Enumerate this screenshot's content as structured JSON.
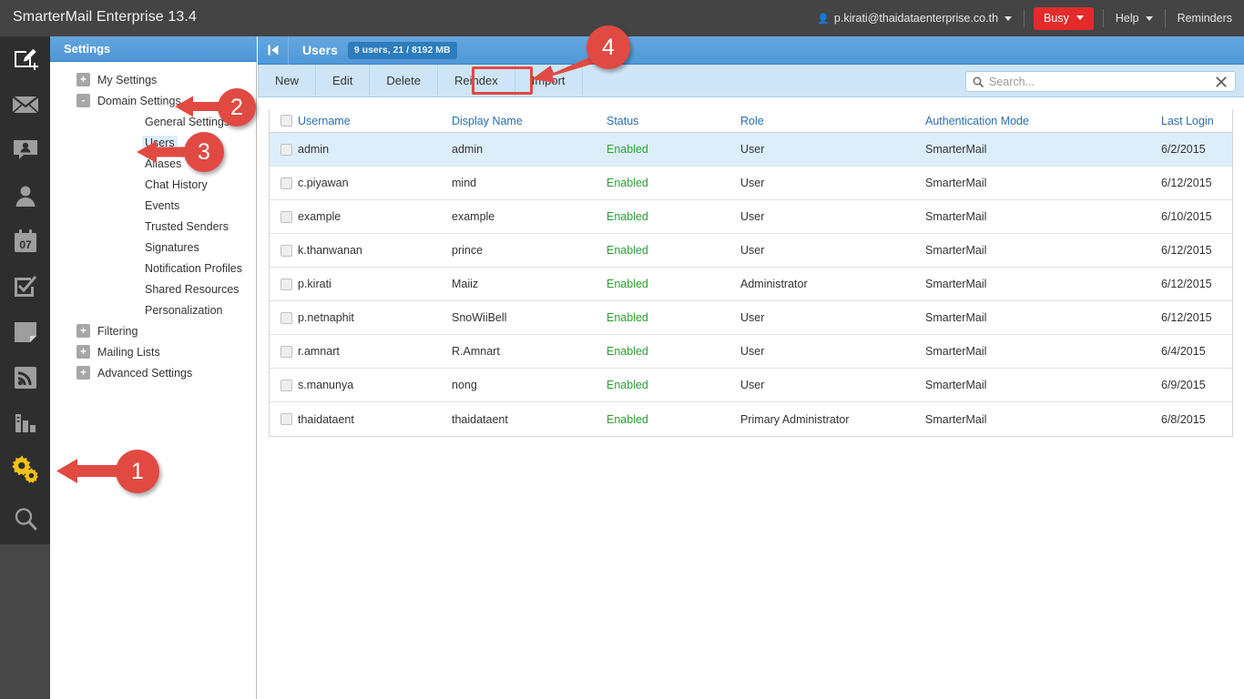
{
  "app": {
    "brand": "SmarterMail Enterprise 13.4",
    "accent_blue": "#4f98d7",
    "accent_red": "#e32b2b",
    "enabled_green": "#2e9e32"
  },
  "topbar": {
    "user_email": "p.kirati@thaidataenterprise.co.th",
    "status_label": "Busy",
    "help_label": "Help",
    "reminders_label": "Reminders"
  },
  "rail": {
    "items": [
      {
        "icon": "compose-new-icon",
        "label": "New"
      },
      {
        "icon": "email-icon",
        "label": "Email"
      },
      {
        "icon": "chat-icon",
        "label": "Chat"
      },
      {
        "icon": "contacts-icon",
        "label": "Contacts"
      },
      {
        "icon": "calendar-icon",
        "label": "Calendar"
      },
      {
        "icon": "tasks-icon",
        "label": "Tasks"
      },
      {
        "icon": "notes-icon",
        "label": "Notes"
      },
      {
        "icon": "rss-icon",
        "label": "RSS Feeds"
      },
      {
        "icon": "reports-icon",
        "label": "Reports"
      },
      {
        "icon": "settings-gear-icon",
        "label": "Settings"
      },
      {
        "icon": "search-icon",
        "label": "Search"
      }
    ]
  },
  "settings": {
    "header": "Settings",
    "tree": [
      {
        "label": "My Settings",
        "level": 1,
        "toggle": "+",
        "selected": false
      },
      {
        "label": "Domain Settings",
        "level": 1,
        "toggle": "-",
        "selected": false
      },
      {
        "label": "General Settings",
        "level": 2,
        "toggle": "",
        "selected": false
      },
      {
        "label": "Users",
        "level": 2,
        "toggle": "",
        "selected": true
      },
      {
        "label": "Aliases",
        "level": 2,
        "toggle": "",
        "selected": false
      },
      {
        "label": "Chat History",
        "level": 2,
        "toggle": "",
        "selected": false
      },
      {
        "label": "Events",
        "level": 2,
        "toggle": "",
        "selected": false
      },
      {
        "label": "Trusted Senders",
        "level": 2,
        "toggle": "",
        "selected": false
      },
      {
        "label": "Signatures",
        "level": 2,
        "toggle": "",
        "selected": false
      },
      {
        "label": "Notification Profiles",
        "level": 2,
        "toggle": "",
        "selected": false
      },
      {
        "label": "Shared Resources",
        "level": 2,
        "toggle": "",
        "selected": false
      },
      {
        "label": "Personalization",
        "level": 2,
        "toggle": "",
        "selected": false
      },
      {
        "label": "Filtering",
        "level": 1,
        "toggle": "+",
        "selected": false
      },
      {
        "label": "Mailing Lists",
        "level": 1,
        "toggle": "+",
        "selected": false
      },
      {
        "label": "Advanced Settings",
        "level": 1,
        "toggle": "+",
        "selected": false
      }
    ]
  },
  "main": {
    "title": "Users",
    "count_badge": "9 users, 21 / 8192 MB",
    "toolbar": [
      "New",
      "Edit",
      "Delete",
      "Reindex",
      "Import"
    ],
    "highlighted_toolbar_button": "Import",
    "search": {
      "value": "",
      "placeholder": "Search..."
    },
    "columns": [
      "Username",
      "Display Name",
      "Status",
      "Role",
      "Authentication Mode",
      "Last Login"
    ],
    "rows": [
      {
        "username": "admin",
        "display": "admin",
        "status": "Enabled",
        "role": "User",
        "auth": "SmarterMail",
        "last": "6/2/2015",
        "selected": true
      },
      {
        "username": "c.piyawan",
        "display": "mind",
        "status": "Enabled",
        "role": "User",
        "auth": "SmarterMail",
        "last": "6/12/2015",
        "selected": false
      },
      {
        "username": "example",
        "display": "example",
        "status": "Enabled",
        "role": "User",
        "auth": "SmarterMail",
        "last": "6/10/2015",
        "selected": false
      },
      {
        "username": "k.thanwanan",
        "display": "prince",
        "status": "Enabled",
        "role": "User",
        "auth": "SmarterMail",
        "last": "6/12/2015",
        "selected": false
      },
      {
        "username": "p.kirati",
        "display": "Maiiz",
        "status": "Enabled",
        "role": "Administrator",
        "auth": "SmarterMail",
        "last": "6/12/2015",
        "selected": false
      },
      {
        "username": "p.netnaphit",
        "display": "SnoWiiBell",
        "status": "Enabled",
        "role": "User",
        "auth": "SmarterMail",
        "last": "6/12/2015",
        "selected": false
      },
      {
        "username": "r.amnart",
        "display": "R.Amnart",
        "status": "Enabled",
        "role": "User",
        "auth": "SmarterMail",
        "last": "6/4/2015",
        "selected": false
      },
      {
        "username": "s.manunya",
        "display": "nong",
        "status": "Enabled",
        "role": "User",
        "auth": "SmarterMail",
        "last": "6/9/2015",
        "selected": false
      },
      {
        "username": "thaidataent",
        "display": "thaidataent",
        "status": "Enabled",
        "role": "Primary Administrator",
        "auth": "SmarterMail",
        "last": "6/8/2015",
        "selected": false
      }
    ]
  },
  "annotations": {
    "color": "#e04a42",
    "markers": [
      {
        "number": "1",
        "target": "settings-gear-icon"
      },
      {
        "number": "2",
        "target": "tree-item-domain-settings"
      },
      {
        "number": "3",
        "target": "tree-item-users"
      },
      {
        "number": "4",
        "target": "toolbar-import-button"
      }
    ]
  }
}
